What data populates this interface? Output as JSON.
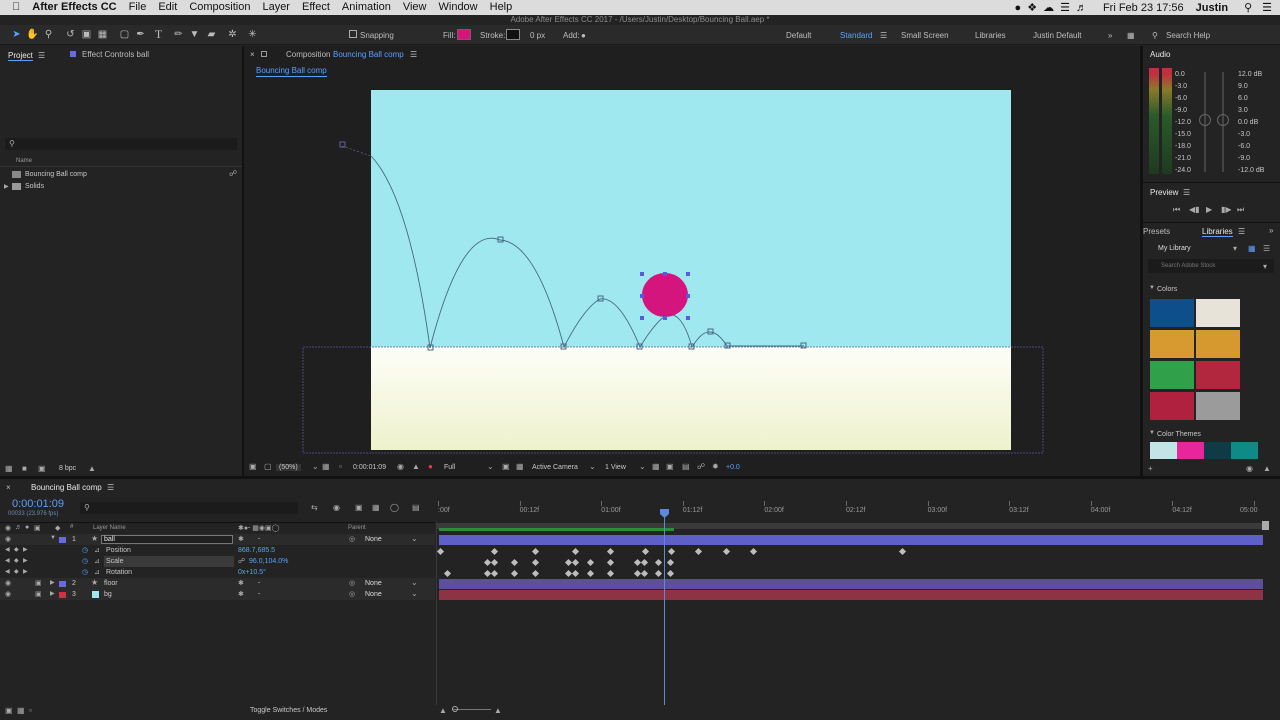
{
  "menubar": {
    "apple": "",
    "items": [
      "After Effects CC",
      "File",
      "Edit",
      "Composition",
      "Layer",
      "Effect",
      "Animation",
      "View",
      "Window",
      "Help"
    ],
    "datetime": "Fri Feb 23  17:56",
    "user": "Justin"
  },
  "window_title": "Adobe After Effects CC 2017 - /Users/Justin/Desktop/Bouncing Ball.aep *",
  "toolbar": {
    "snapping": "Snapping",
    "fill": "Fill:",
    "stroke": "Stroke:",
    "stroke_px": "0 px",
    "add": "Add:",
    "workspaces": [
      "Default",
      "Standard",
      "Small Screen",
      "Libraries",
      "Justin Default"
    ],
    "search": "Search Help",
    "fill_color": "#d4157e"
  },
  "project": {
    "tab1": "Project",
    "tab2": "Effect Controls ball",
    "col_name": "Name",
    "items": [
      "Bouncing Ball comp",
      "Solids"
    ],
    "bpc": "8 bpc"
  },
  "composition": {
    "tab": "Composition",
    "comp_name": "Bouncing Ball comp",
    "breadcrumb": "Bouncing Ball comp",
    "zoom": "(50%)",
    "timecode": "0:00:01:09",
    "quality": "Full",
    "camera": "Active Camera",
    "views": "1 View",
    "exposure": "+0.0",
    "sky_color": "#a0e8f0",
    "ground_color": "#f7f9e2",
    "ball_color": "#d4157e"
  },
  "audio": {
    "title": "Audio",
    "left_scale": [
      "0.0",
      "-3.0",
      "-6.0",
      "-9.0",
      "-12.0",
      "-15.0",
      "-18.0",
      "-21.0",
      "-24.0"
    ],
    "right_scale": [
      "12.0 dB",
      "9.0",
      "6.0",
      "3.0",
      "0.0 dB",
      "-3.0",
      "-6.0",
      "-9.0",
      "-12.0 dB"
    ]
  },
  "preview": {
    "title": "Preview"
  },
  "libraries": {
    "tab1": "Presets",
    "tab2": "Libraries",
    "library": "My Library",
    "search": "Search Adobe Stock",
    "colors_title": "Colors",
    "colors": [
      "#0d4f8a",
      "#e8e3d8",
      "#d69a31",
      "#d6992f",
      "#30a04b",
      "#b3273e",
      "#b0213f",
      "#9b9b9b"
    ],
    "themes_title": "Color Themes",
    "themes": [
      "#c3e4e6",
      "#e8259a",
      "#0e3b46",
      "#0f8a86"
    ]
  },
  "timeline": {
    "tab": "Bouncing Ball comp",
    "timecode": "0:00:01:09",
    "frames": "00033 (23.976 fps)",
    "col_layer": "Layer Name",
    "col_parent": "Parent",
    "ruler": [
      ":00f",
      "00:12f",
      "01:00f",
      "01:12f",
      "02:00f",
      "02:12f",
      "03:00f",
      "03:12f",
      "04:00f",
      "04:12f",
      "05:00"
    ],
    "layers": [
      {
        "num": "1",
        "name": "ball",
        "parent": "None",
        "color": "#6a6ae0"
      },
      {
        "num": "2",
        "name": "floor",
        "parent": "None",
        "color": "#6a6ae0"
      },
      {
        "num": "3",
        "name": "bg",
        "parent": "None",
        "color": "#cc3344"
      }
    ],
    "props": [
      {
        "name": "Position",
        "value": "868.7,685.5"
      },
      {
        "name": "Scale",
        "value": "96.0,104.0%"
      },
      {
        "name": "Rotation",
        "value": "0x+10.5°"
      }
    ],
    "toggle": "Toggle Switches / Modes"
  }
}
